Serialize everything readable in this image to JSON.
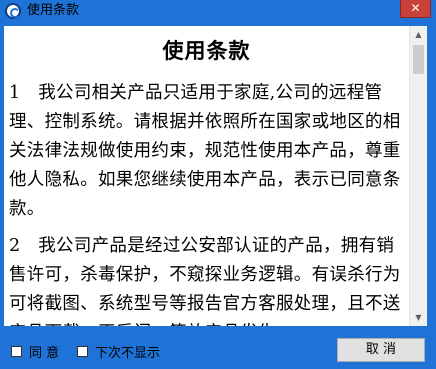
{
  "window": {
    "title": "使用条款",
    "close_label": "✕"
  },
  "document": {
    "heading": "使用条款",
    "paragraphs": [
      "1　我公司相关产品只适用于家庭,公司的远程管理、控制系统。请根据并依照所在国家或地区的相关法律法规做使用约束，规范性使用本产品，尊重他人隐私。如果您继续使用本产品，表示已同意条款。",
      "2　我公司产品是经过公安部认证的产品，拥有销售许可，杀毒保护，不窥探业务逻辑。有误杀行为可将截图、系统型号等报告官方客服处理，且不送产品下载，正后门，等放产品发生"
    ]
  },
  "footer": {
    "agree_label": "同 意",
    "no_more_label": "下次不显示",
    "cancel_label": "取 消"
  }
}
